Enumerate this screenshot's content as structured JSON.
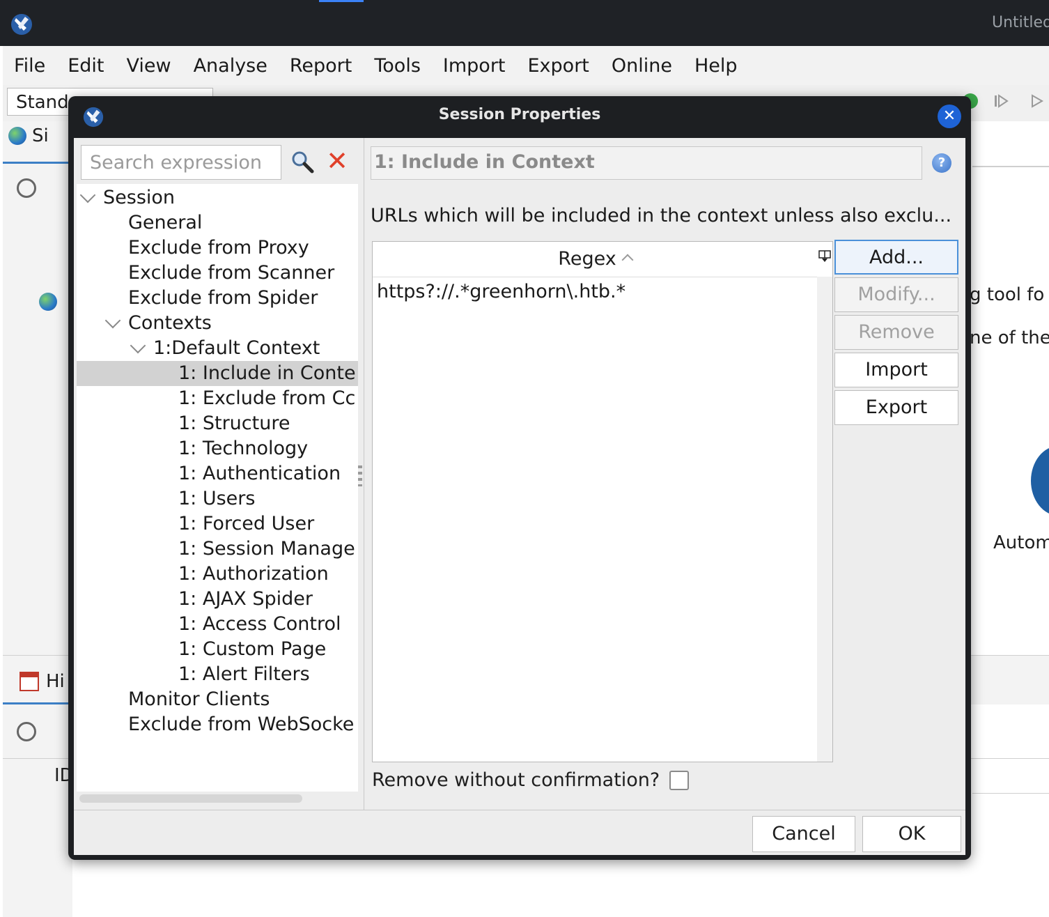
{
  "window": {
    "title": "Untitled"
  },
  "menubar": [
    "File",
    "Edit",
    "View",
    "Analyse",
    "Report",
    "Tools",
    "Import",
    "Export",
    "Online",
    "Help"
  ],
  "toolbar": {
    "mode": "Stand"
  },
  "background": {
    "sites_tab": "Si",
    "history_tab": "Hi",
    "id_col": "ID",
    "right_text_1": "g tool fo",
    "right_text_2": "ne of the",
    "right_text_3": "Autom"
  },
  "dialog": {
    "title": "Session Properties",
    "search_placeholder": "Search expression",
    "tree": [
      {
        "label": "Session",
        "level": 0,
        "expanded": true
      },
      {
        "label": "General",
        "level": 1
      },
      {
        "label": "Exclude from Proxy",
        "level": 1
      },
      {
        "label": "Exclude from Scanner",
        "level": 1
      },
      {
        "label": "Exclude from Spider",
        "level": 1
      },
      {
        "label": "Contexts",
        "level": 1,
        "expanded": true
      },
      {
        "label": "1:Default Context",
        "level": 2,
        "expanded": true
      },
      {
        "label": "1: Include in Conte",
        "level": 3,
        "selected": true
      },
      {
        "label": "1: Exclude from Cc",
        "level": 3
      },
      {
        "label": "1: Structure",
        "level": 3
      },
      {
        "label": "1: Technology",
        "level": 3
      },
      {
        "label": "1: Authentication",
        "level": 3
      },
      {
        "label": "1: Users",
        "level": 3
      },
      {
        "label": "1: Forced User",
        "level": 3
      },
      {
        "label": "1: Session Manage",
        "level": 3
      },
      {
        "label": "1: Authorization",
        "level": 3
      },
      {
        "label": "1: AJAX Spider",
        "level": 3
      },
      {
        "label": "1: Access Control",
        "level": 3
      },
      {
        "label": "1: Custom Page",
        "level": 3
      },
      {
        "label": "1: Alert Filters",
        "level": 3
      },
      {
        "label": "Monitor Clients",
        "level": 1
      },
      {
        "label": "Exclude from WebSocke",
        "level": 1
      }
    ],
    "section_title": "1: Include in Context",
    "description": "URLs which will be included in the context unless also exclu...",
    "table": {
      "column": "Regex",
      "rows": [
        "https?://.*greenhorn\\.htb.*"
      ]
    },
    "buttons": {
      "add": "Add...",
      "modify": "Modify...",
      "remove": "Remove",
      "import": "Import",
      "export": "Export"
    },
    "confirm_label": "Remove without confirmation?",
    "footer": {
      "cancel": "Cancel",
      "ok": "OK"
    }
  },
  "colors": {
    "accent": "#1e63d6",
    "selection": "#d2d2d2",
    "titlebar": "#1f2226"
  }
}
